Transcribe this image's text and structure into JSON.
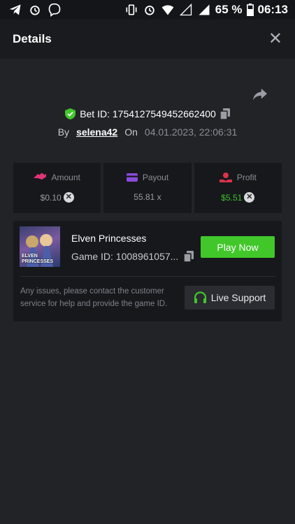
{
  "status_bar": {
    "battery": "65 %",
    "time": "06:13"
  },
  "header": {
    "title": "Details",
    "close": "✕"
  },
  "bet": {
    "id_label": "Bet ID: 1754127549452662400",
    "by": "By",
    "user": "selena42",
    "on": "On",
    "date": "04.01.2023, 22:06:31"
  },
  "stats": [
    {
      "label": "Amount",
      "value": "$0.10",
      "icon": "coins-icon",
      "color": "#e0357a"
    },
    {
      "label": "Payout",
      "value": "55.81 x",
      "icon": "card-icon",
      "color": "#8a4bdc"
    },
    {
      "label": "Profit",
      "value": "$5.51",
      "icon": "hand-coin-icon",
      "color": "#d9344a"
    }
  ],
  "game": {
    "name": "Elven Princesses",
    "game_id": "Game ID: 1008961057...",
    "thumb_text": "ELVEN PRINCESSES",
    "play_label": "Play Now",
    "issues_text": "Any issues, please contact the customer service for help and provide the game ID.",
    "support_label": "Live Support"
  },
  "colors": {
    "accent_green": "#41c72a",
    "bg": "#222327"
  }
}
